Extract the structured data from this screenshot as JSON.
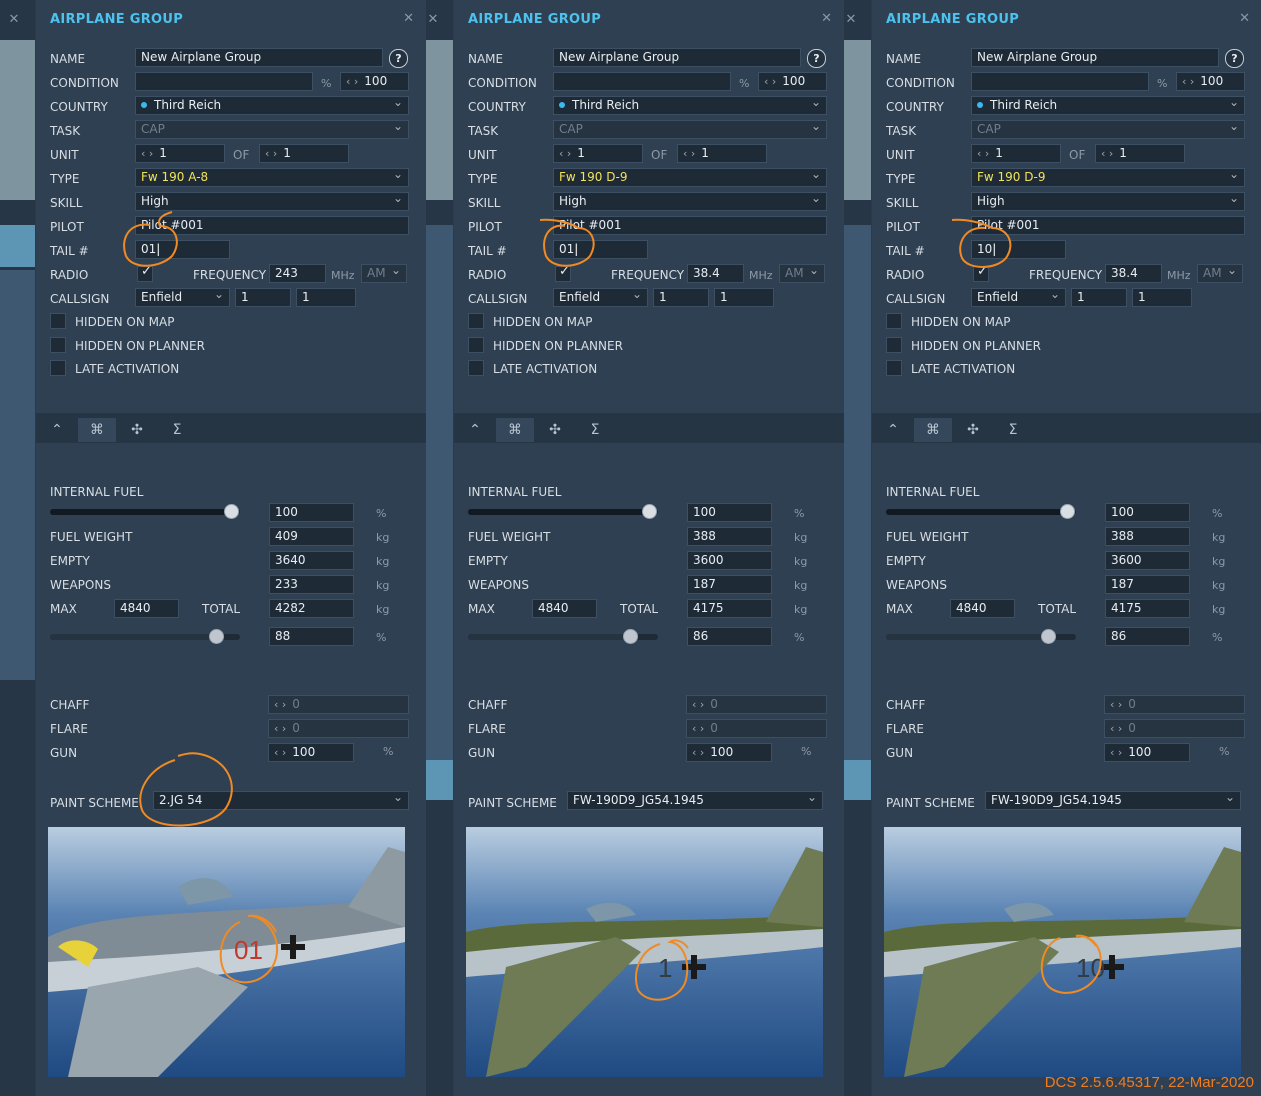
{
  "panels": [
    {
      "title": "AIRPLANE GROUP",
      "labels": {
        "name": "NAME",
        "condition": "CONDITION",
        "country": "COUNTRY",
        "task": "TASK",
        "unit": "UNIT",
        "of": "OF",
        "type": "TYPE",
        "skill": "SKILL",
        "pilot": "PILOT",
        "tail": "TAIL #",
        "radio": "RADIO",
        "frequency": "FREQUENCY",
        "callsign": "CALLSIGN",
        "hidden_map": "HIDDEN ON MAP",
        "hidden_planner": "HIDDEN ON PLANNER",
        "late_activation": "LATE ACTIVATION",
        "internal_fuel": "INTERNAL FUEL",
        "fuel_weight": "FUEL WEIGHT",
        "empty": "EMPTY",
        "weapons": "WEAPONS",
        "max": "MAX",
        "total": "TOTAL",
        "chaff": "CHAFF",
        "flare": "FLARE",
        "gun": "GUN",
        "paint_scheme": "PAINT SCHEME"
      },
      "units": {
        "percent": "%",
        "mhz": "MHz",
        "kg": "kg"
      },
      "help": "?",
      "name": "New Airplane Group",
      "condition_value": "100",
      "country": "Third Reich",
      "task": "CAP",
      "unit_value": "1",
      "unit_of": "1",
      "type": "Fw 190 A-8",
      "skill": "High",
      "pilot": "Pilot #001",
      "tail": "01",
      "radio_checked": true,
      "frequency": "243",
      "modulation": "AM",
      "callsign": "Enfield",
      "callsign_n1": "1",
      "callsign_n2": "1",
      "internal_fuel": "100",
      "internal_fuel_level": 0.96,
      "fuel_weight": "409",
      "empty_weight": "3640",
      "weapons_weight": "233",
      "max_weight": "4840",
      "total_weight": "4282",
      "total_percent": "88",
      "total_level": 0.88,
      "chaff": "0",
      "flare": "0",
      "gun": "100",
      "paint_scheme": "2.JG 54",
      "aircraft_number": "01",
      "number_color": "#c0392b"
    },
    {
      "title": "AIRPLANE GROUP",
      "labels": {
        "name": "NAME",
        "condition": "CONDITION",
        "country": "COUNTRY",
        "task": "TASK",
        "unit": "UNIT",
        "of": "OF",
        "type": "TYPE",
        "skill": "SKILL",
        "pilot": "PILOT",
        "tail": "TAIL #",
        "radio": "RADIO",
        "frequency": "FREQUENCY",
        "callsign": "CALLSIGN",
        "hidden_map": "HIDDEN ON MAP",
        "hidden_planner": "HIDDEN ON PLANNER",
        "late_activation": "LATE ACTIVATION",
        "internal_fuel": "INTERNAL FUEL",
        "fuel_weight": "FUEL WEIGHT",
        "empty": "EMPTY",
        "weapons": "WEAPONS",
        "max": "MAX",
        "total": "TOTAL",
        "chaff": "CHAFF",
        "flare": "FLARE",
        "gun": "GUN",
        "paint_scheme": "PAINT SCHEME"
      },
      "units": {
        "percent": "%",
        "mhz": "MHz",
        "kg": "kg"
      },
      "help": "?",
      "name": "New Airplane Group",
      "condition_value": "100",
      "country": "Third Reich",
      "task": "CAP",
      "unit_value": "1",
      "unit_of": "1",
      "type": "Fw 190 D-9",
      "skill": "High",
      "pilot": "Pilot #001",
      "tail": "01",
      "radio_checked": true,
      "frequency": "38.4",
      "modulation": "AM",
      "callsign": "Enfield",
      "callsign_n1": "1",
      "callsign_n2": "1",
      "internal_fuel": "100",
      "internal_fuel_level": 0.96,
      "fuel_weight": "388",
      "empty_weight": "3600",
      "weapons_weight": "187",
      "max_weight": "4840",
      "total_weight": "4175",
      "total_percent": "86",
      "total_level": 0.86,
      "chaff": "0",
      "flare": "0",
      "gun": "100",
      "paint_scheme": "FW-190D9_JG54.1945",
      "aircraft_number": "1",
      "number_color": "#333c44"
    },
    {
      "title": "AIRPLANE GROUP",
      "labels": {
        "name": "NAME",
        "condition": "CONDITION",
        "country": "COUNTRY",
        "task": "TASK",
        "unit": "UNIT",
        "of": "OF",
        "type": "TYPE",
        "skill": "SKILL",
        "pilot": "PILOT",
        "tail": "TAIL #",
        "radio": "RADIO",
        "frequency": "FREQUENCY",
        "callsign": "CALLSIGN",
        "hidden_map": "HIDDEN ON MAP",
        "hidden_planner": "HIDDEN ON PLANNER",
        "late_activation": "LATE ACTIVATION",
        "internal_fuel": "INTERNAL FUEL",
        "fuel_weight": "FUEL WEIGHT",
        "empty": "EMPTY",
        "weapons": "WEAPONS",
        "max": "MAX",
        "total": "TOTAL",
        "chaff": "CHAFF",
        "flare": "FLARE",
        "gun": "GUN",
        "paint_scheme": "PAINT SCHEME"
      },
      "units": {
        "percent": "%",
        "mhz": "MHz",
        "kg": "kg"
      },
      "help": "?",
      "name": "New Airplane Group",
      "condition_value": "100",
      "country": "Third Reich",
      "task": "CAP",
      "unit_value": "1",
      "unit_of": "1",
      "type": "Fw 190 D-9",
      "skill": "High",
      "pilot": "Pilot #001",
      "tail": "10",
      "radio_checked": true,
      "frequency": "38.4",
      "modulation": "AM",
      "callsign": "Enfield",
      "callsign_n1": "1",
      "callsign_n2": "1",
      "internal_fuel": "100",
      "internal_fuel_level": 0.96,
      "fuel_weight": "388",
      "empty_weight": "3600",
      "weapons_weight": "187",
      "max_weight": "4840",
      "total_weight": "4175",
      "total_percent": "86",
      "total_level": 0.86,
      "chaff": "0",
      "flare": "0",
      "gun": "100",
      "paint_scheme": "FW-190D9_JG54.1945",
      "aircraft_number": "10",
      "number_color": "#333c44"
    }
  ],
  "icons": {
    "close": "close-icon",
    "route": "route-icon",
    "payload": "payload-icon",
    "failures": "failures-icon",
    "summary": "summary-icon",
    "dropdown": "chevron-down-icon",
    "stepper": "stepper-arrows-icon",
    "checkmark": "checkmark-icon"
  },
  "colors": {
    "title_accent": "#4dc2ee",
    "type_highlight": "#f2e35a",
    "annotation": "#f08a24",
    "country_dot": "#3ab8f0"
  },
  "footer": {
    "version": "DCS 2.5.6.45317, 22-Mar-2020"
  }
}
